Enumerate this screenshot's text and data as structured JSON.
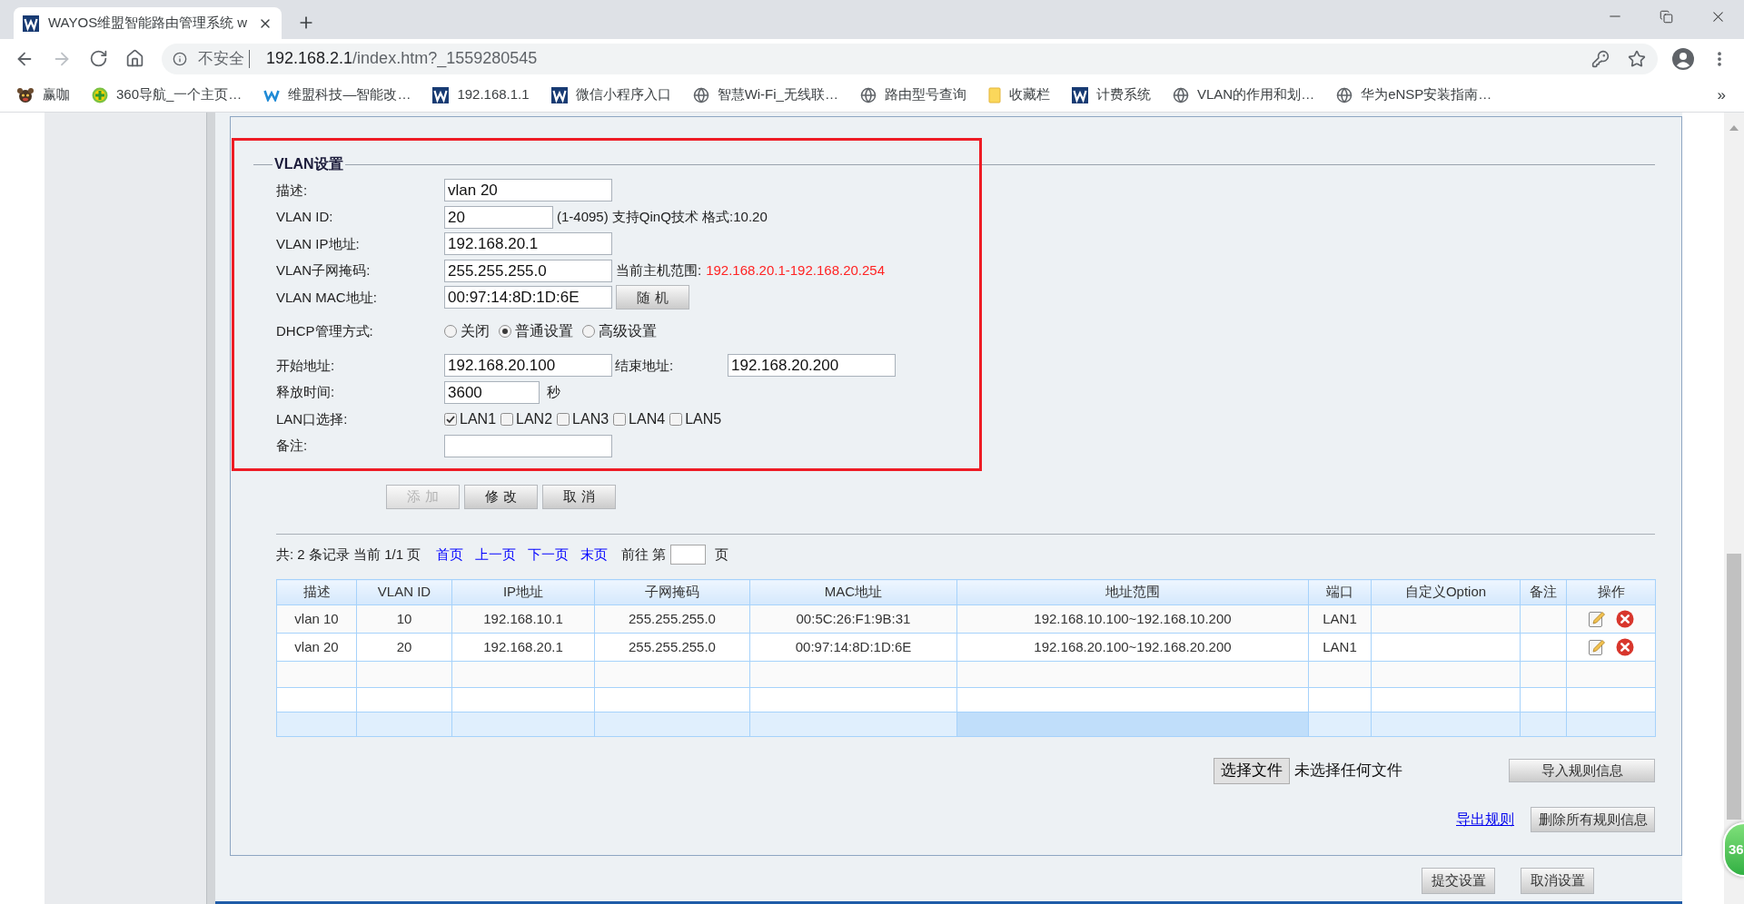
{
  "browser": {
    "tab": {
      "title": "WAYOS维盟智能路由管理系统 w"
    },
    "navigation": {
      "back_disabled": false,
      "forward_disabled": true
    },
    "address": {
      "security": "不安全",
      "host": "192.168.2.1",
      "path": "/index.htm?_1559280545"
    },
    "bookmarks": [
      {
        "kind": "mascot",
        "label": "赢咖"
      },
      {
        "kind": "plus_badge",
        "label": "360导航_一个主页…"
      },
      {
        "kind": "w_letter",
        "label": "维盟科技—智能改…"
      },
      {
        "kind": "w_tile",
        "label": "192.168.1.1"
      },
      {
        "kind": "w_tile",
        "label": "微信小程序入口"
      },
      {
        "kind": "globe",
        "label": "智慧Wi-Fi_无线联…"
      },
      {
        "kind": "globe",
        "label": "路由型号查询"
      },
      {
        "kind": "folder",
        "label": "收藏栏"
      },
      {
        "kind": "w_tile",
        "label": "计费系统"
      },
      {
        "kind": "globe",
        "label": "VLAN的作用和划…"
      },
      {
        "kind": "globe",
        "label": "华为eNSP安装指南…"
      }
    ],
    "bookmarks_overflow": "»"
  },
  "vlan_settings": {
    "legend": "VLAN设置",
    "fields": [
      {
        "kind": "input",
        "label": "描述:",
        "value": "vlan 20"
      },
      {
        "kind": "id_input",
        "label": "VLAN ID:",
        "value": "20",
        "hint": "(1-4095) 支持QinQ技术 格式:10.20"
      },
      {
        "kind": "input",
        "label": "VLAN IP地址:",
        "value": "192.168.20.1"
      },
      {
        "kind": "input",
        "label": "VLAN子网掩码:",
        "value": "255.255.255.0",
        "hint": "当前主机范围:",
        "range": "192.168.20.1-192.168.20.254"
      },
      {
        "kind": "input",
        "label": "VLAN MAC地址:",
        "value": "00:97:14:8D:1D:6E",
        "button": "随 机"
      },
      {
        "kind": "radios",
        "label": "DHCP管理方式:",
        "options": [
          {
            "label": "关闭",
            "selected": false
          },
          {
            "label": "普通设置",
            "selected": true
          },
          {
            "label": "高级设置",
            "selected": false
          }
        ]
      },
      {
        "kind": "input",
        "label": "开始地址:",
        "value": "192.168.20.100",
        "second_label": "结束地址:",
        "second_value": "192.168.20.200"
      },
      {
        "kind": "short_input",
        "label": "释放时间:",
        "value": "3600",
        "unit": "秒"
      },
      {
        "kind": "checkboxes",
        "label": "LAN口选择:",
        "options": [
          {
            "label": "LAN1",
            "checked": true
          },
          {
            "label": "LAN2",
            "checked": false
          },
          {
            "label": "LAN3",
            "checked": false
          },
          {
            "label": "LAN4",
            "checked": false
          },
          {
            "label": "LAN5",
            "checked": false
          }
        ]
      },
      {
        "kind": "input",
        "label": "备注:"
      }
    ],
    "buttons": [
      {
        "label": "添 加",
        "disabled": true
      },
      {
        "label": "修 改",
        "disabled": false
      },
      {
        "label": "取 消",
        "disabled": false
      }
    ]
  },
  "records": {
    "pagination": {
      "summary": "共: 2 条记录 当前 1/1 页",
      "links": [
        "首页",
        "上一页",
        "下一页",
        "末页"
      ],
      "goto_label": "前往 第",
      "goto_suffix": "页"
    },
    "columns": [
      "描述",
      "VLAN ID",
      "IP地址",
      "子网掩码",
      "MAC地址",
      "地址范围",
      "端口",
      "自定义Option",
      "备注",
      "操作"
    ],
    "rows": [
      {
        "cells": [
          "vlan 10",
          "10",
          "192.168.10.1",
          "255.255.255.0",
          "00:5C:26:F1:9B:31",
          "192.168.10.100~192.168.10.200",
          "LAN1"
        ]
      },
      {
        "cells": [
          "vlan 20",
          "20",
          "192.168.20.1",
          "255.255.255.0",
          "00:97:14:8D:1D:6E",
          "192.168.20.100~192.168.20.200",
          "LAN1"
        ]
      }
    ],
    "blank_rows": [
      {
        "highlighted": false,
        "hovered": [
          false,
          false,
          false,
          false,
          false,
          false,
          false,
          false,
          false,
          false
        ]
      },
      {
        "highlighted": false,
        "hovered": [
          false,
          false,
          false,
          false,
          false,
          false,
          false,
          false,
          false,
          false
        ]
      },
      {
        "highlighted": true,
        "hovered": [
          false,
          false,
          false,
          false,
          false,
          true,
          false,
          false,
          false,
          false
        ]
      }
    ]
  },
  "file_import": {
    "choose_button": "选择文件",
    "file_status": "未选择任何文件",
    "import_button": "导入规则信息",
    "export_link": "导出规则",
    "delete_all_button": "删除所有规则信息"
  },
  "footer_buttons": [
    {
      "label": "提交设置"
    },
    {
      "label": "取消设置"
    }
  ],
  "floating_widget": {
    "label": "36"
  }
}
